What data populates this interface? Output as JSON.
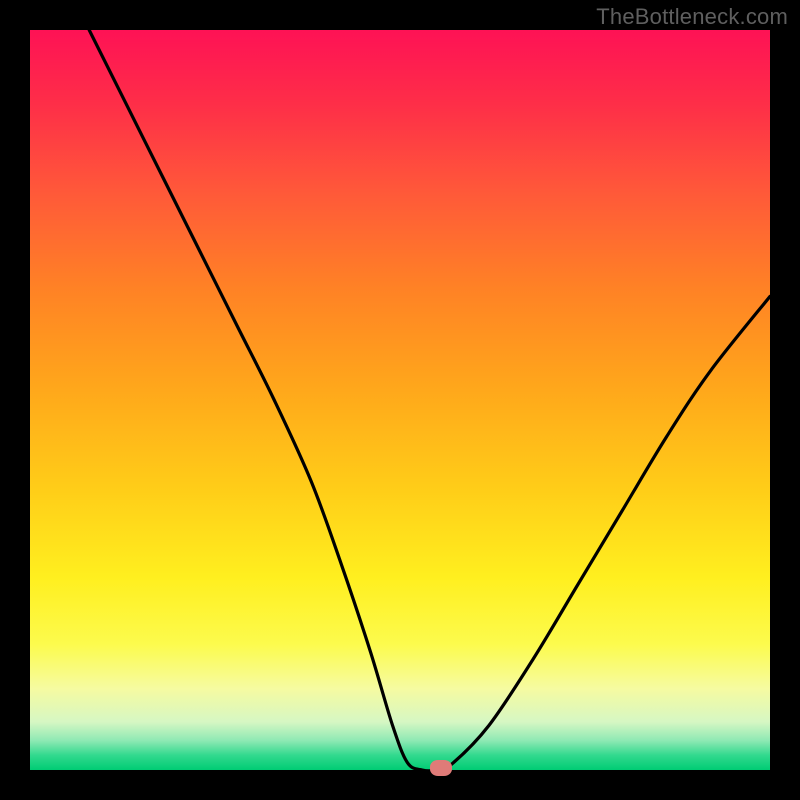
{
  "watermark": "TheBottleneck.com",
  "chart_data": {
    "type": "line",
    "title": "",
    "xlabel": "",
    "ylabel": "",
    "xlim": [
      0,
      100
    ],
    "ylim": [
      0,
      100
    ],
    "grid": false,
    "legend": false,
    "series": [
      {
        "name": "curve",
        "color": "#000000",
        "x": [
          8,
          12,
          18,
          23,
          28,
          33,
          38,
          42,
          46,
          49,
          51,
          53,
          55,
          57,
          62,
          68,
          74,
          80,
          86,
          92,
          100
        ],
        "y": [
          100,
          92,
          80,
          70,
          60,
          50,
          39,
          28,
          16,
          6,
          1,
          0,
          0,
          0.8,
          6,
          15,
          25,
          35,
          45,
          54,
          64
        ]
      }
    ],
    "marker": {
      "x": 55.6,
      "y": 0.3,
      "color": "#df7b78"
    },
    "background_gradient": {
      "orientation": "vertical",
      "stops": [
        {
          "pos": 0.0,
          "color": "#fe1255"
        },
        {
          "pos": 0.1,
          "color": "#fe2e48"
        },
        {
          "pos": 0.22,
          "color": "#ff5939"
        },
        {
          "pos": 0.35,
          "color": "#ff8225"
        },
        {
          "pos": 0.48,
          "color": "#ffa61b"
        },
        {
          "pos": 0.62,
          "color": "#ffcd18"
        },
        {
          "pos": 0.74,
          "color": "#ffef1f"
        },
        {
          "pos": 0.83,
          "color": "#fcfb4d"
        },
        {
          "pos": 0.89,
          "color": "#f6fba1"
        },
        {
          "pos": 0.935,
          "color": "#d6f7c3"
        },
        {
          "pos": 0.96,
          "color": "#8fe9b4"
        },
        {
          "pos": 0.98,
          "color": "#32d98e"
        },
        {
          "pos": 1.0,
          "color": "#00cc74"
        }
      ]
    }
  }
}
